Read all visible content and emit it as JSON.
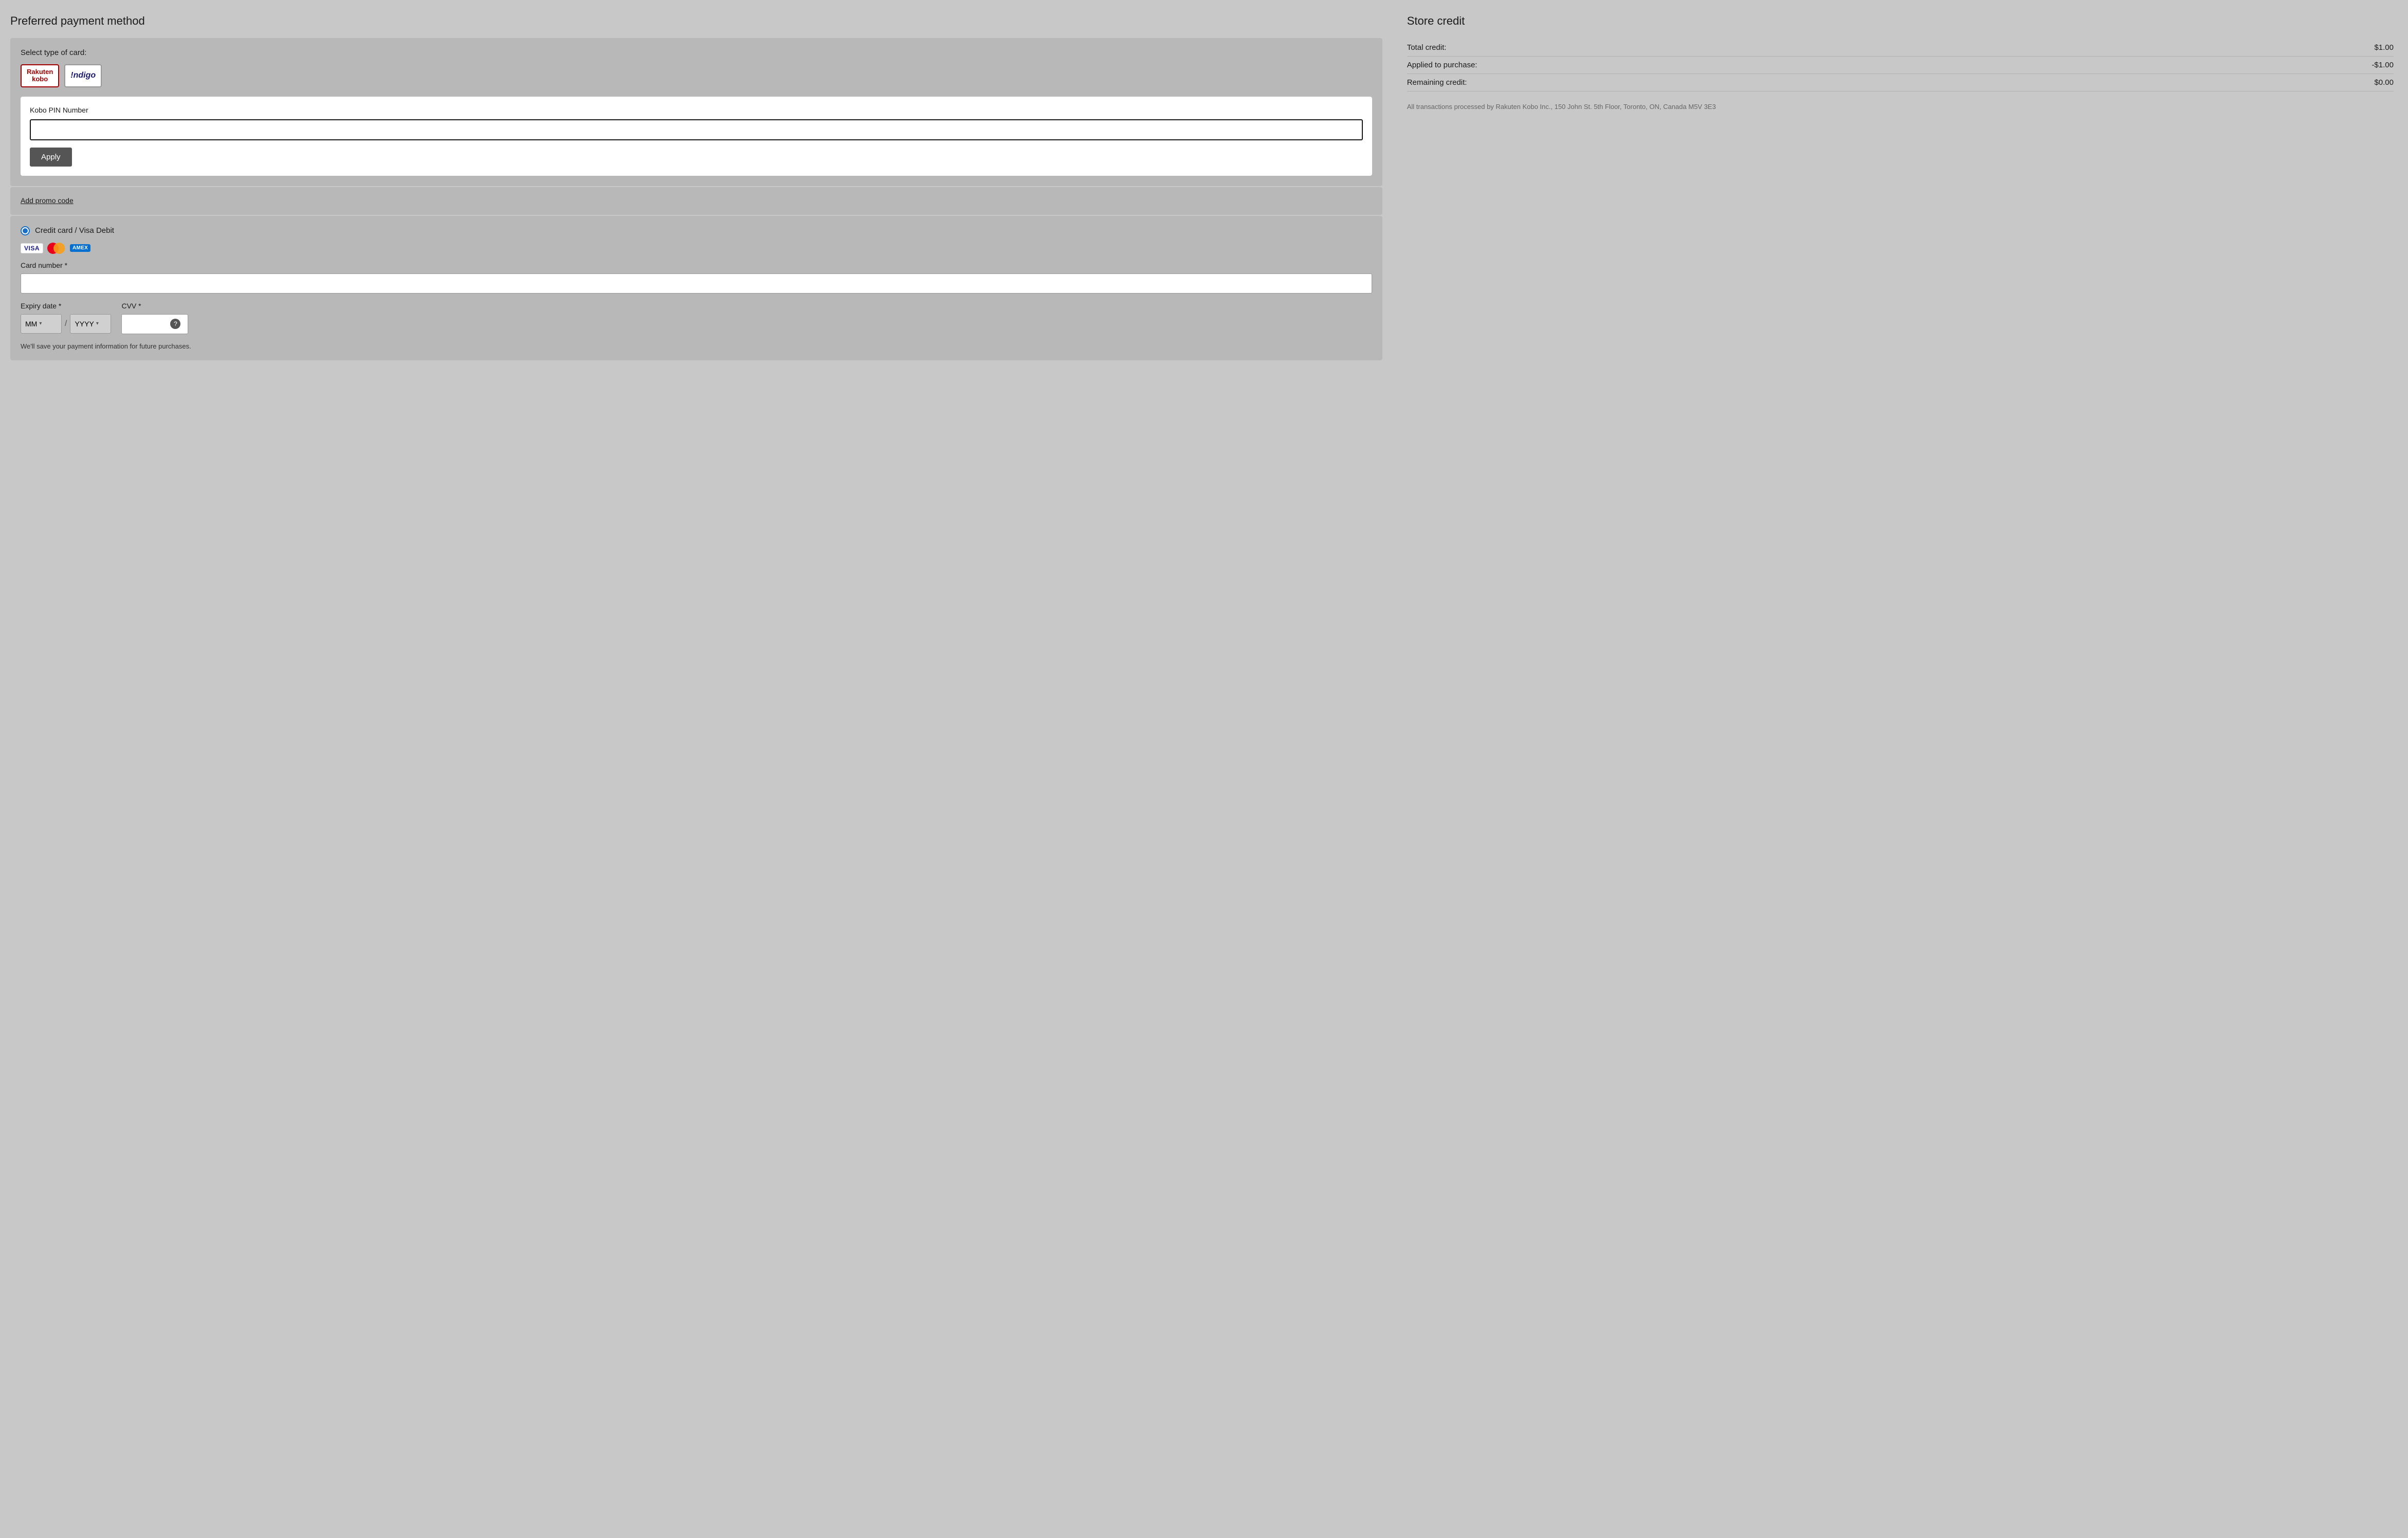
{
  "left": {
    "title": "Preferred payment method",
    "card_section": {
      "label": "Select type of card:",
      "cards": [
        {
          "id": "rakuten-kobo",
          "line1": "Rakuten",
          "line2": "kobo",
          "selected": true
        },
        {
          "id": "indigo",
          "text": "!ndigo",
          "selected": false
        }
      ]
    },
    "pin": {
      "label": "Kobo PIN Number",
      "placeholder": "",
      "apply_btn": "Apply"
    },
    "promo": {
      "link_text": "Add promo code"
    },
    "payment": {
      "radio_label": "Credit card / Visa Debit",
      "card_number_label": "Card number *",
      "expiry_label": "Expiry date *",
      "cvv_label": "CVV *",
      "mm_placeholder": "MM",
      "yyyy_placeholder": "YYYY",
      "save_note": "We'll save your payment information for future purchases."
    }
  },
  "right": {
    "title": "Store credit",
    "rows": [
      {
        "label": "Total credit:",
        "value": "$1.00"
      },
      {
        "label": "Applied to purchase:",
        "value": "-$1.00"
      },
      {
        "label": "Remaining credit:",
        "value": "$0.00"
      }
    ],
    "legal": "All transactions processed by Rakuten Kobo Inc., 150 John St. 5th Floor, Toronto, ON, Canada M5V 3E3"
  },
  "icons": {
    "question_mark": "?",
    "chevron_down": "▾"
  }
}
